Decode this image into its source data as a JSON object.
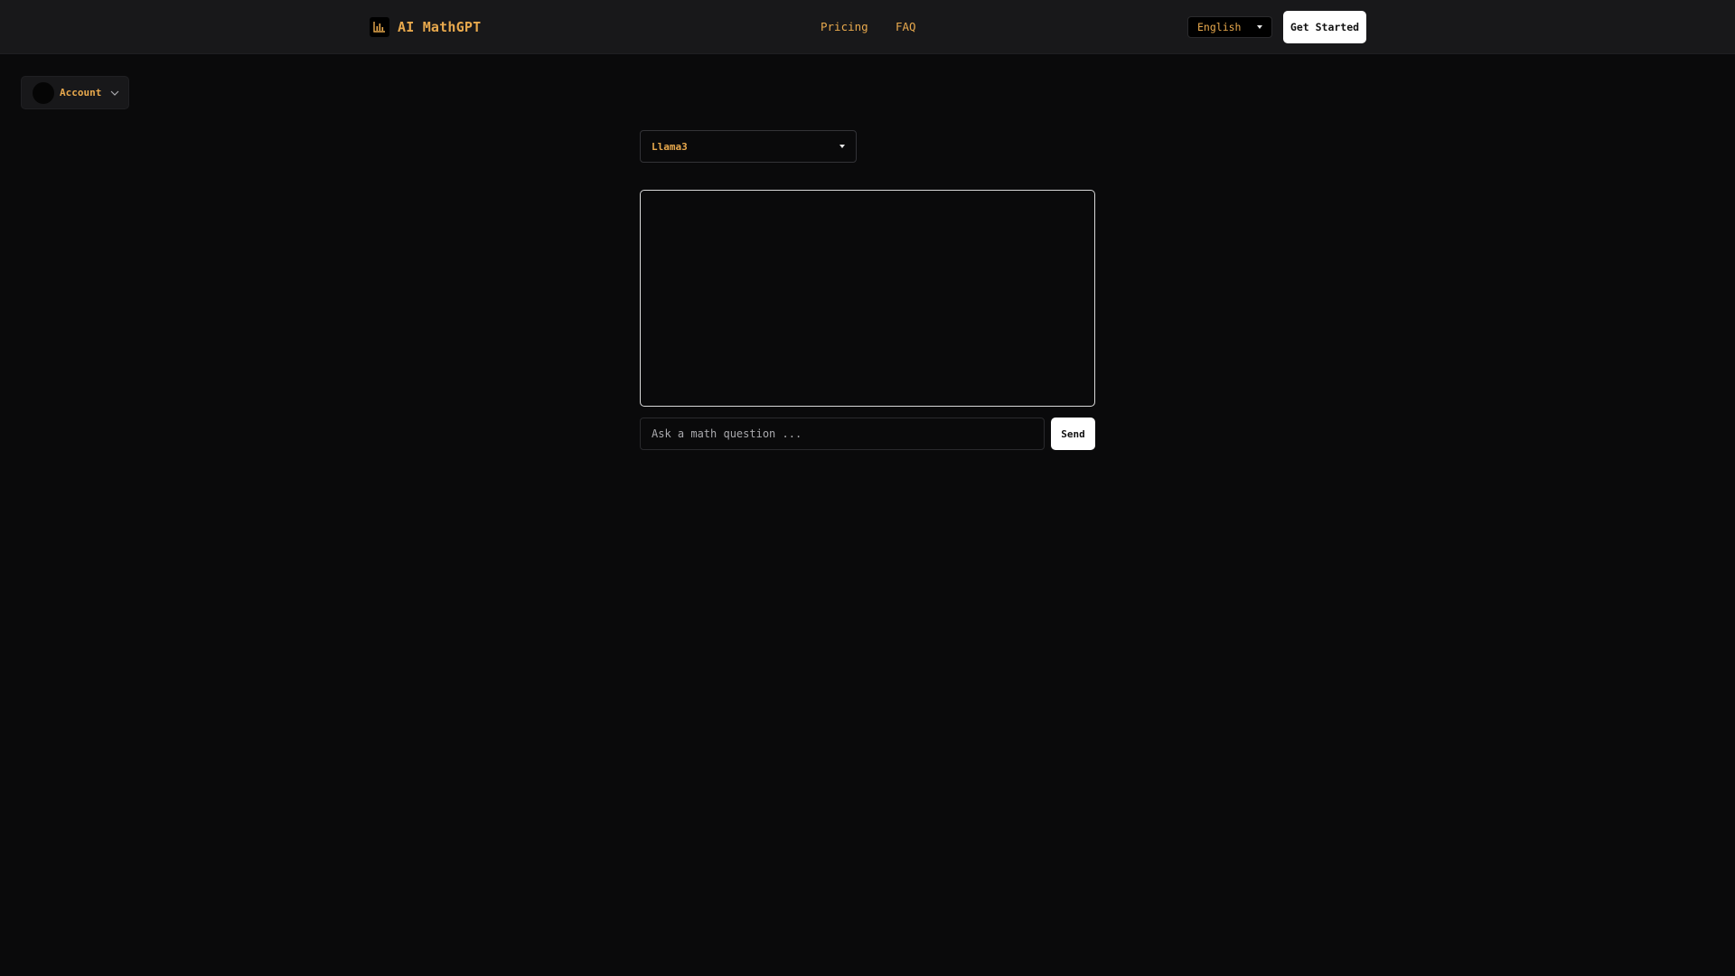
{
  "header": {
    "logo_text": "AI MathGPT",
    "logo_icon": "bar-chart-icon",
    "nav": [
      {
        "label": "Pricing"
      },
      {
        "label": "FAQ"
      }
    ],
    "language": "English",
    "cta_label": "Get Started"
  },
  "account": {
    "label": "Account",
    "icon": "chevron-down-icon"
  },
  "chat": {
    "model": "Llama3",
    "input_placeholder": "Ask a math question ...",
    "send_label": "Send"
  },
  "colors": {
    "accent": "#e8a94d",
    "background": "#0a0a0b",
    "header_bg": "#18181a"
  }
}
